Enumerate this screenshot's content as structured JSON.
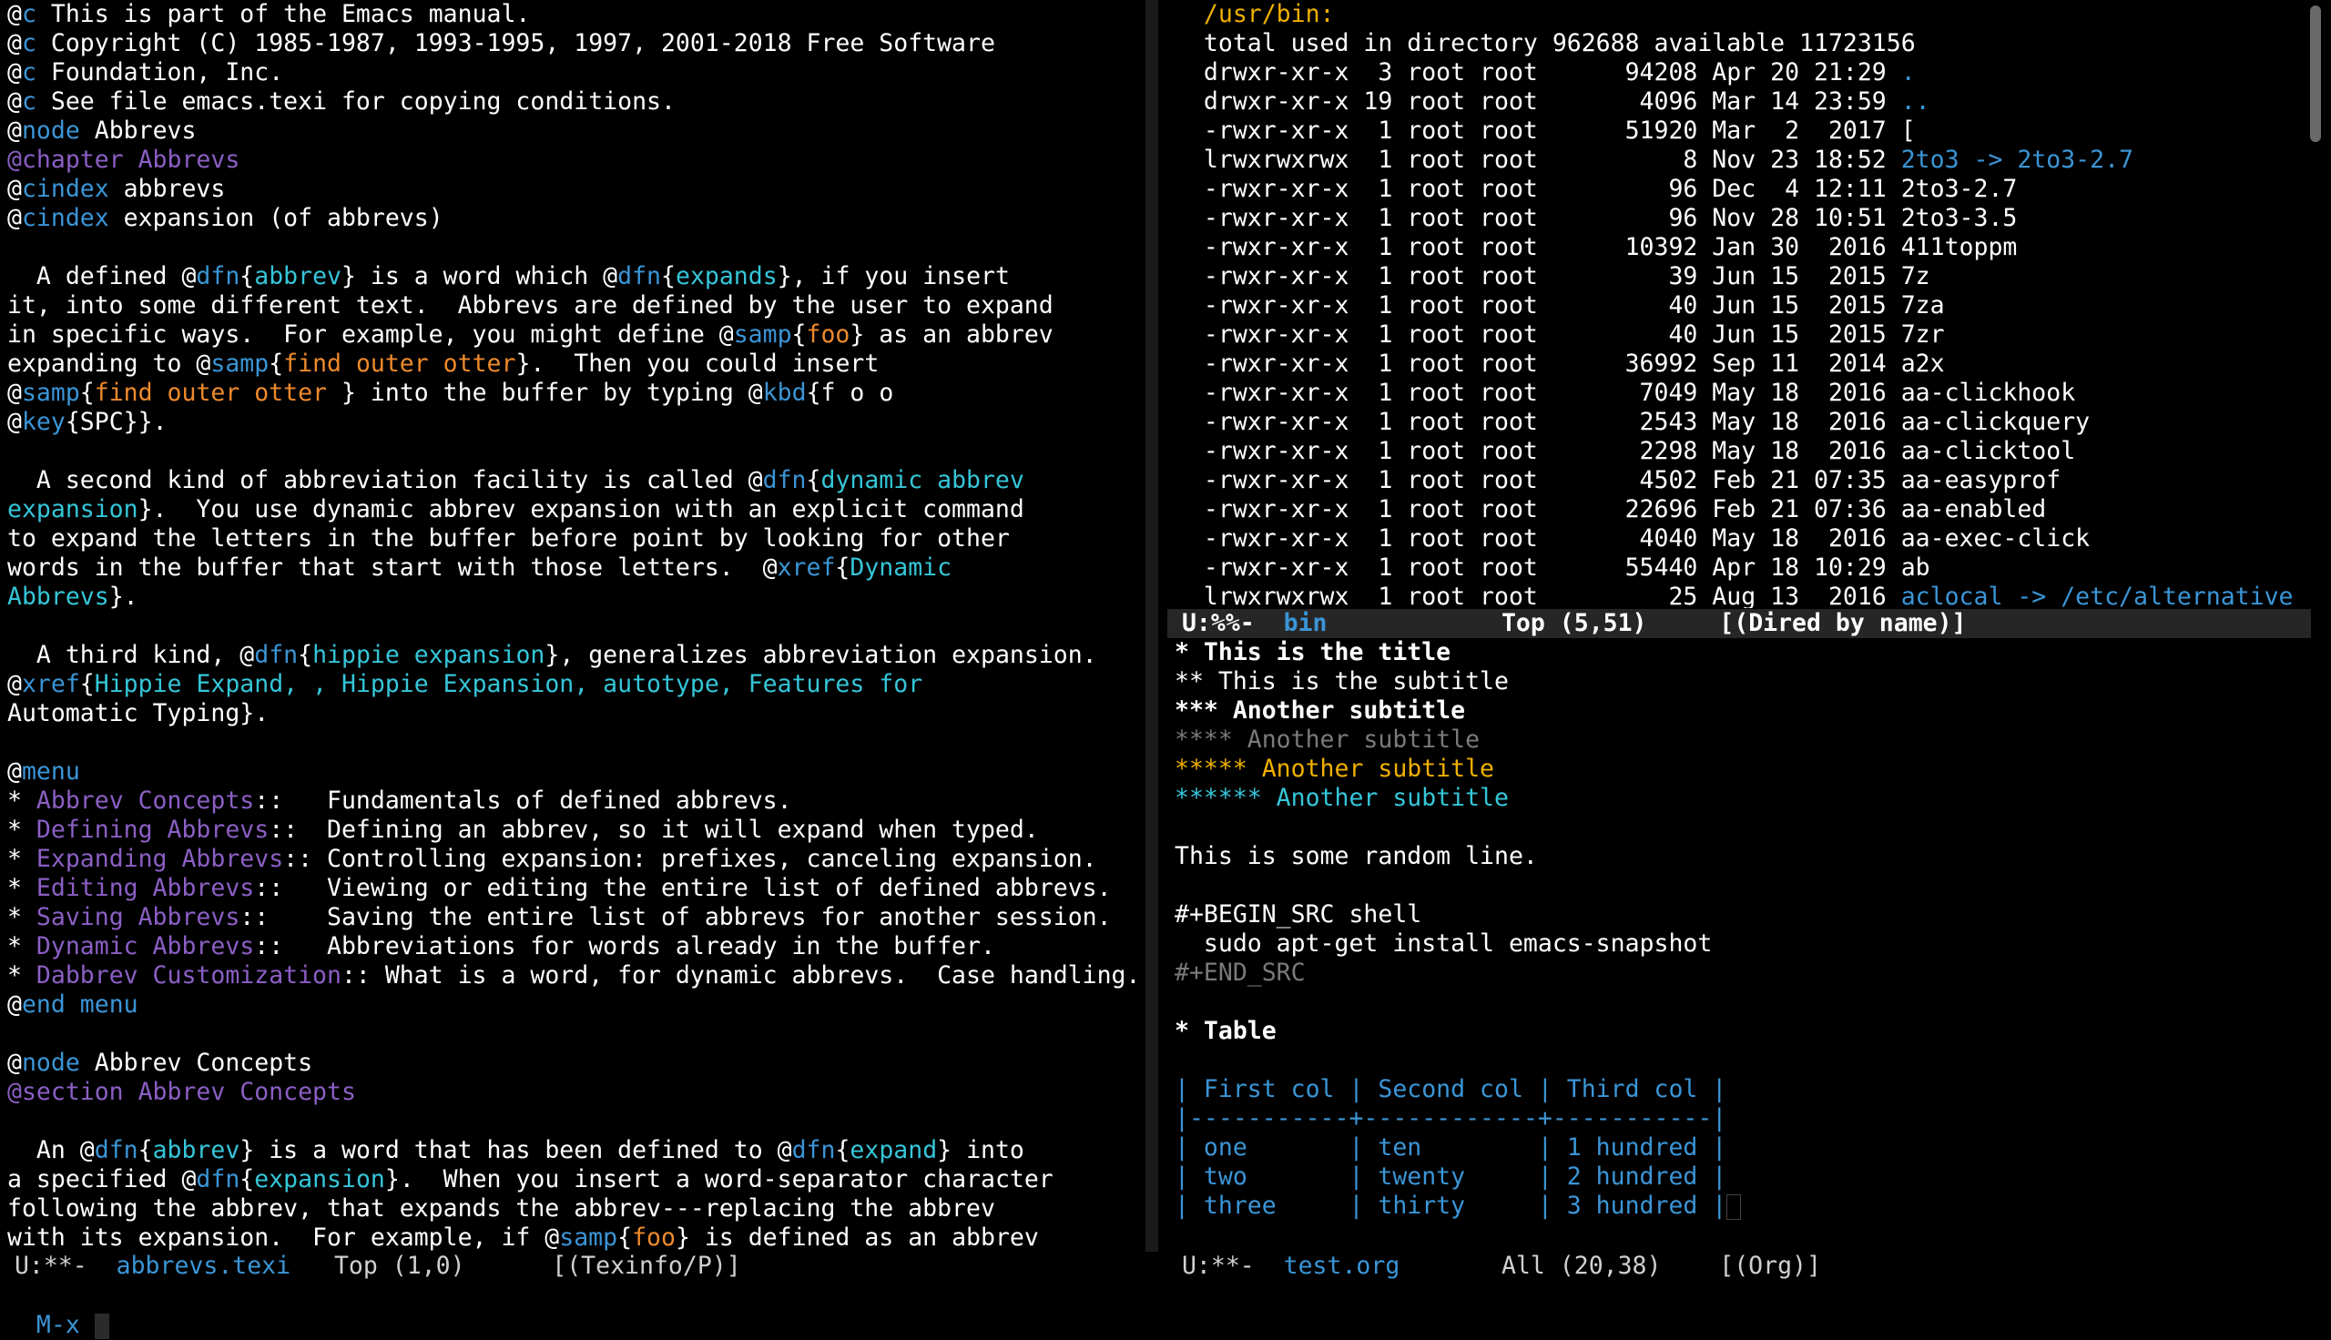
{
  "colors": {
    "background": "#000000",
    "default": "#ffffff",
    "keyword": "#3b95d6",
    "chapter": "#8b5fc4",
    "cyan": "#35c6d9",
    "orange": "#ee8a2c",
    "dim": "#7a7a7a",
    "menu_item": "#8b5fc4",
    "dir_link": "#3b95d6",
    "gold": "#f0b000",
    "modeline_bg": "#262626"
  },
  "left_pane": {
    "lines": [
      [
        [
          "@",
          "default"
        ],
        [
          "c",
          "keyword"
        ],
        [
          " This is part of the Emacs manual.",
          "default"
        ]
      ],
      [
        [
          "@",
          "default"
        ],
        [
          "c",
          "keyword"
        ],
        [
          " Copyright (C) 1985-1987, 1993-1995, 1997, 2001-2018 Free Software",
          "default"
        ]
      ],
      [
        [
          "@",
          "default"
        ],
        [
          "c",
          "keyword"
        ],
        [
          " Foundation, Inc.",
          "default"
        ]
      ],
      [
        [
          "@",
          "default"
        ],
        [
          "c",
          "keyword"
        ],
        [
          " See file emacs.texi for copying conditions.",
          "default"
        ]
      ],
      [
        [
          "@",
          "default"
        ],
        [
          "node",
          "keyword"
        ],
        [
          " Abbrevs",
          "default"
        ]
      ],
      [
        [
          "@chapter Abbrevs",
          "chapter"
        ]
      ],
      [
        [
          "@",
          "default"
        ],
        [
          "cindex",
          "keyword"
        ],
        [
          " abbrevs",
          "default"
        ]
      ],
      [
        [
          "@",
          "default"
        ],
        [
          "cindex",
          "keyword"
        ],
        [
          " expansion (of abbrevs)",
          "default"
        ]
      ],
      [
        [
          "",
          "default"
        ]
      ],
      [
        [
          "  A defined @",
          "default"
        ],
        [
          "dfn",
          "keyword"
        ],
        [
          "{",
          "default"
        ],
        [
          "abbrev",
          "cyan"
        ],
        [
          "} is a word which @",
          "default"
        ],
        [
          "dfn",
          "keyword"
        ],
        [
          "{",
          "default"
        ],
        [
          "expands",
          "cyan"
        ],
        [
          "}, if you insert",
          "default"
        ]
      ],
      [
        [
          "it, into some different text.  Abbrevs are defined by the user to expand",
          "default"
        ]
      ],
      [
        [
          "in specific ways.  For example, you might define @",
          "default"
        ],
        [
          "samp",
          "keyword"
        ],
        [
          "{",
          "default"
        ],
        [
          "foo",
          "orange"
        ],
        [
          "} as an abbrev",
          "default"
        ]
      ],
      [
        [
          "expanding to @",
          "default"
        ],
        [
          "samp",
          "keyword"
        ],
        [
          "{",
          "default"
        ],
        [
          "find outer otter",
          "orange"
        ],
        [
          "}.  Then you could insert",
          "default"
        ]
      ],
      [
        [
          "@",
          "default"
        ],
        [
          "samp",
          "keyword"
        ],
        [
          "{",
          "default"
        ],
        [
          "find outer otter ",
          "orange"
        ],
        [
          "} into the buffer by typing @",
          "default"
        ],
        [
          "kbd",
          "keyword"
        ],
        [
          "{f o o",
          "default"
        ]
      ],
      [
        [
          "@",
          "default"
        ],
        [
          "key",
          "keyword"
        ],
        [
          "{SPC}}.",
          "default"
        ]
      ],
      [
        [
          "",
          "default"
        ]
      ],
      [
        [
          "  A second kind of abbreviation facility is called @",
          "default"
        ],
        [
          "dfn",
          "keyword"
        ],
        [
          "{",
          "default"
        ],
        [
          "dynamic abbrev",
          "cyan"
        ]
      ],
      [
        [
          "expansion",
          "cyan"
        ],
        [
          "}.  You use dynamic abbrev expansion with an explicit command",
          "default"
        ]
      ],
      [
        [
          "to expand the letters in the buffer before point by looking for other",
          "default"
        ]
      ],
      [
        [
          "words in the buffer that start with those letters.  @",
          "default"
        ],
        [
          "xref",
          "keyword"
        ],
        [
          "{",
          "default"
        ],
        [
          "Dynamic",
          "cyan"
        ]
      ],
      [
        [
          "Abbrevs",
          "cyan"
        ],
        [
          "}.",
          "default"
        ]
      ],
      [
        [
          "",
          "default"
        ]
      ],
      [
        [
          "  A third kind, @",
          "default"
        ],
        [
          "dfn",
          "keyword"
        ],
        [
          "{",
          "default"
        ],
        [
          "hippie expansion",
          "cyan"
        ],
        [
          "}, generalizes abbreviation expansion.",
          "default"
        ]
      ],
      [
        [
          "@",
          "default"
        ],
        [
          "xref",
          "keyword"
        ],
        [
          "{",
          "default"
        ],
        [
          "Hippie Expand, , Hippie Expansion, autotype, Features for",
          "cyan"
        ]
      ],
      [
        [
          "Automatic Typing}.",
          "default"
        ]
      ],
      [
        [
          "",
          "default"
        ]
      ],
      [
        [
          "@",
          "default"
        ],
        [
          "menu",
          "keyword"
        ]
      ],
      [
        [
          "* ",
          "default"
        ],
        [
          "Abbrev Concepts",
          "menu_item"
        ],
        [
          "::   Fundamentals of defined abbrevs.",
          "default"
        ]
      ],
      [
        [
          "* ",
          "default"
        ],
        [
          "Defining Abbrevs",
          "menu_item"
        ],
        [
          "::  Defining an abbrev, so it will expand when typed.",
          "default"
        ]
      ],
      [
        [
          "* ",
          "default"
        ],
        [
          "Expanding Abbrevs",
          "menu_item"
        ],
        [
          ":: Controlling expansion: prefixes, canceling expansion.",
          "default"
        ]
      ],
      [
        [
          "* ",
          "default"
        ],
        [
          "Editing Abbrevs",
          "menu_item"
        ],
        [
          "::   Viewing or editing the entire list of defined abbrevs.",
          "default"
        ]
      ],
      [
        [
          "* ",
          "default"
        ],
        [
          "Saving Abbrevs",
          "menu_item"
        ],
        [
          "::    Saving the entire list of abbrevs for another session.",
          "default"
        ]
      ],
      [
        [
          "* ",
          "default"
        ],
        [
          "Dynamic Abbrevs",
          "menu_item"
        ],
        [
          "::   Abbreviations for words already in the buffer.",
          "default"
        ]
      ],
      [
        [
          "* ",
          "default"
        ],
        [
          "Dabbrev Customization",
          "menu_item"
        ],
        [
          ":: What is a word, for dynamic abbrevs.  Case handling.",
          "default"
        ]
      ],
      [
        [
          "@",
          "default"
        ],
        [
          "end menu",
          "keyword"
        ]
      ],
      [
        [
          "",
          "default"
        ]
      ],
      [
        [
          "@",
          "default"
        ],
        [
          "node",
          "keyword"
        ],
        [
          " Abbrev Concepts",
          "default"
        ]
      ],
      [
        [
          "@section Abbrev Concepts",
          "chapter"
        ]
      ],
      [
        [
          "",
          "default"
        ]
      ],
      [
        [
          "  An @",
          "default"
        ],
        [
          "dfn",
          "keyword"
        ],
        [
          "{",
          "default"
        ],
        [
          "abbrev",
          "cyan"
        ],
        [
          "} is a word that has been defined to @",
          "default"
        ],
        [
          "dfn",
          "keyword"
        ],
        [
          "{",
          "default"
        ],
        [
          "expand",
          "cyan"
        ],
        [
          "} into",
          "default"
        ]
      ],
      [
        [
          "a specified @",
          "default"
        ],
        [
          "dfn",
          "keyword"
        ],
        [
          "{",
          "default"
        ],
        [
          "expansion",
          "cyan"
        ],
        [
          "}.  When you insert a word-separator character",
          "default"
        ]
      ],
      [
        [
          "following the abbrev, that expands the abbrev---replacing the abbrev",
          "default"
        ]
      ],
      [
        [
          "with its expansion.  For example, if @",
          "default"
        ],
        [
          "samp",
          "keyword"
        ],
        [
          "{",
          "default"
        ],
        [
          "foo",
          "orange"
        ],
        [
          "} is defined as an abbrev",
          "default"
        ]
      ]
    ],
    "modeline": [
      [
        " U:**-  ",
        "default"
      ],
      [
        "abbrevs.texi",
        "keyword"
      ],
      [
        "   Top (1,0)      [(Texinfo/P)]",
        "default"
      ]
    ]
  },
  "dired_pane": {
    "lines": [
      [
        [
          "  /usr/bin:",
          "gold"
        ]
      ],
      [
        [
          "  total used in directory 962688 available 11723156",
          "default"
        ]
      ],
      [
        [
          "  drwxr-xr-x  3 root root      94208 Apr 20 21:29 ",
          "default"
        ],
        [
          ".",
          "dir_link"
        ]
      ],
      [
        [
          "  drwxr-xr-x 19 root root       4096 Mar 14 23:59 ",
          "default"
        ],
        [
          "..",
          "dir_link"
        ]
      ],
      [
        [
          "  -rwxr-xr-x  1 root root      51920 Mar  2  2017 [",
          "default"
        ]
      ],
      [
        [
          "  lrwxrwxrwx  1 root root          8 Nov 23 18:52 ",
          "default"
        ],
        [
          "2to3 -> 2to3-2.7",
          "dir_link"
        ]
      ],
      [
        [
          "  -rwxr-xr-x  1 root root         96 Dec  4 12:11 2to3-2.7",
          "default"
        ]
      ],
      [
        [
          "  -rwxr-xr-x  1 root root         96 Nov 28 10:51 2to3-3.5",
          "default"
        ]
      ],
      [
        [
          "  -rwxr-xr-x  1 root root      10392 Jan 30  2016 411toppm",
          "default"
        ]
      ],
      [
        [
          "  -rwxr-xr-x  1 root root         39 Jun 15  2015 7z",
          "default"
        ]
      ],
      [
        [
          "  -rwxr-xr-x  1 root root         40 Jun 15  2015 7za",
          "default"
        ]
      ],
      [
        [
          "  -rwxr-xr-x  1 root root         40 Jun 15  2015 7zr",
          "default"
        ]
      ],
      [
        [
          "  -rwxr-xr-x  1 root root      36992 Sep 11  2014 a2x",
          "default"
        ]
      ],
      [
        [
          "  -rwxr-xr-x  1 root root       7049 May 18  2016 aa-clickhook",
          "default"
        ]
      ],
      [
        [
          "  -rwxr-xr-x  1 root root       2543 May 18  2016 aa-clickquery",
          "default"
        ]
      ],
      [
        [
          "  -rwxr-xr-x  1 root root       2298 May 18  2016 aa-clicktool",
          "default"
        ]
      ],
      [
        [
          "  -rwxr-xr-x  1 root root       4502 Feb 21 07:35 aa-easyprof",
          "default"
        ]
      ],
      [
        [
          "  -rwxr-xr-x  1 root root      22696 Feb 21 07:36 aa-enabled",
          "default"
        ]
      ],
      [
        [
          "  -rwxr-xr-x  1 root root       4040 May 18  2016 aa-exec-click",
          "default"
        ]
      ],
      [
        [
          "  -rwxr-xr-x  1 root root      55440 Apr 18 10:29 ab",
          "default"
        ]
      ],
      [
        [
          "  lrwxrwxrwx  1 root root         25 Aug 13  2016 ",
          "default"
        ],
        [
          "aclocal -> /etc/alternative",
          "dir_link"
        ]
      ]
    ],
    "modeline": [
      [
        " U:%%-  ",
        "default"
      ],
      [
        "bin",
        "keyword"
      ],
      [
        "            Top (5,51)     [(Dired by name)]",
        "default"
      ]
    ]
  },
  "org_pane": {
    "lines": [
      [
        [
          "* This is the title",
          "bold"
        ]
      ],
      [
        [
          "** This is the subtitle",
          "default"
        ]
      ],
      [
        [
          "*** Another subtitle",
          "bold"
        ]
      ],
      [
        [
          "**** Another subtitle",
          "dim"
        ]
      ],
      [
        [
          "***** Another subtitle",
          "gold"
        ]
      ],
      [
        [
          "****** Another subtitle",
          "cyan"
        ]
      ],
      [
        [
          "",
          "default"
        ]
      ],
      [
        [
          "This is some random line.",
          "default"
        ]
      ],
      [
        [
          "",
          "default"
        ]
      ],
      [
        [
          "#+BEGIN_SRC shell",
          "default"
        ]
      ],
      [
        [
          "  sudo apt-get install emacs-snapshot",
          "default"
        ]
      ],
      [
        [
          "#+END_SRC",
          "dim"
        ]
      ],
      [
        [
          "",
          "default"
        ]
      ],
      [
        [
          "* Table",
          "bold"
        ]
      ],
      [
        [
          "",
          "default"
        ]
      ],
      [
        [
          "| First col | Second col | Third col |",
          "keyword"
        ]
      ],
      [
        [
          "|-----------+------------+-----------|",
          "keyword"
        ]
      ],
      [
        [
          "| one       | ten        | 1 hundred |",
          "keyword"
        ]
      ],
      [
        [
          "| two       | twenty     | 2 hundred |",
          "keyword"
        ]
      ],
      [
        [
          "| three     | thirty     | 3 hundred |",
          "keyword"
        ]
      ]
    ],
    "modeline": [
      [
        " U:**-  ",
        "default"
      ],
      [
        "test.org",
        "keyword"
      ],
      [
        "       All (20,38)    [(Org)]",
        "default"
      ]
    ]
  },
  "minibuffer": {
    "prompt": "M-x"
  }
}
